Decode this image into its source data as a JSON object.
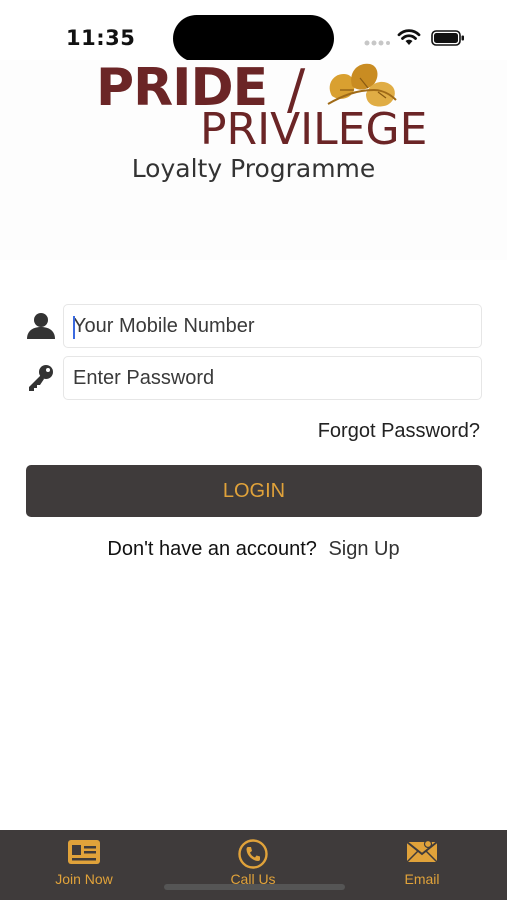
{
  "status_bar": {
    "time": "11:35"
  },
  "logo": {
    "brand_top": "PRIDE",
    "brand_slash": "/",
    "brand_bottom": "PRIVILEGE",
    "tagline": "Loyalty Programme",
    "colors": {
      "brand": "#6b2526",
      "leaf": "#d9a030"
    }
  },
  "form": {
    "mobile": {
      "placeholder": "Your Mobile Number",
      "value": "",
      "icon": "user-icon"
    },
    "password": {
      "placeholder": "Enter Password",
      "value": "",
      "icon": "key-icon"
    },
    "forgot_label": "Forgot Password?",
    "login_label": "LOGIN",
    "no_account_text": "Don't have an account?",
    "signup_label": "Sign Up"
  },
  "bottom_nav": {
    "items": [
      {
        "label": "Join Now",
        "icon": "id-card-icon"
      },
      {
        "label": "Call Us",
        "icon": "phone-icon"
      },
      {
        "label": "Email",
        "icon": "envelope-icon"
      }
    ]
  },
  "colors": {
    "accent": "#e0a23a",
    "dark": "#3f3b3b"
  }
}
